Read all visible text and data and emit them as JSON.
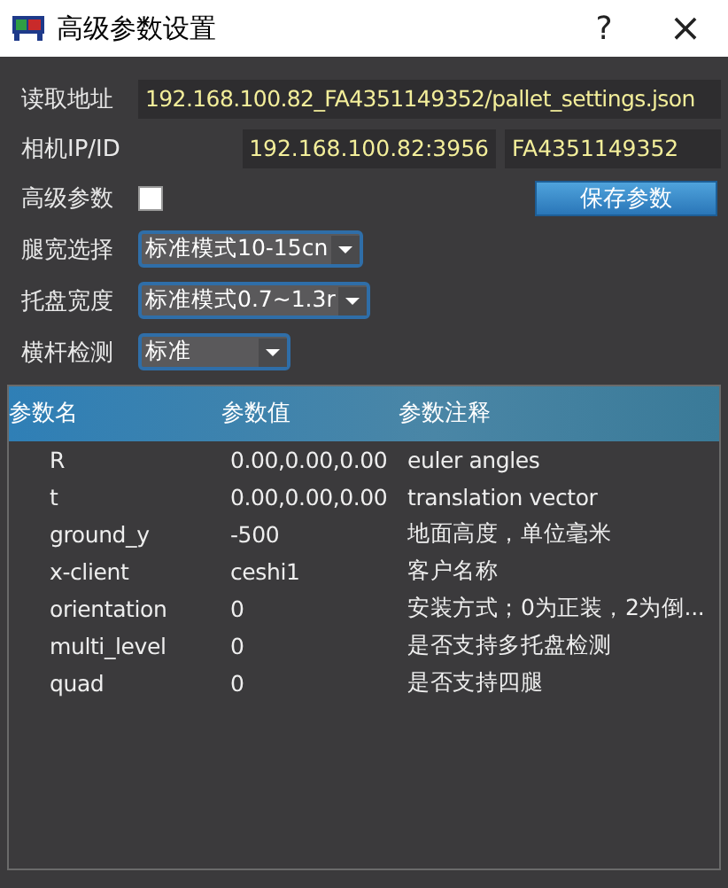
{
  "window": {
    "title": "高级参数设置",
    "help": "?",
    "close": "×"
  },
  "address": {
    "label": "读取地址",
    "value": "192.168.100.82_FA4351149352/pallet_settings.json"
  },
  "camera": {
    "label": "相机IP/ID",
    "ip": "192.168.100.82:3956",
    "id": "FA4351149352"
  },
  "advanced": {
    "label": "高级参数",
    "checked": false
  },
  "save_button": "保存参数",
  "selects": [
    {
      "label": "腿宽选择",
      "value": "标准模式10-15cn"
    },
    {
      "label": "托盘宽度",
      "value": "标准模式0.7~1.3r"
    },
    {
      "label": "横杆检测",
      "value": "标准"
    }
  ],
  "table": {
    "columns": [
      "参数名",
      "参数值",
      "参数注释"
    ],
    "rows": [
      [
        "R",
        "0.00,0.00,0.00",
        "euler angles"
      ],
      [
        "t",
        "0.00,0.00,0.00",
        "translation vector"
      ],
      [
        "ground_y",
        "-500",
        "地面高度，单位毫米"
      ],
      [
        "x-client",
        "ceshi1",
        "客户名称"
      ],
      [
        "orientation",
        "0",
        "安装方式；0为正装，2为倒..."
      ],
      [
        "multi_level",
        "0",
        "是否支持多托盘检测"
      ],
      [
        "quad",
        "0",
        "是否支持四腿"
      ]
    ]
  }
}
